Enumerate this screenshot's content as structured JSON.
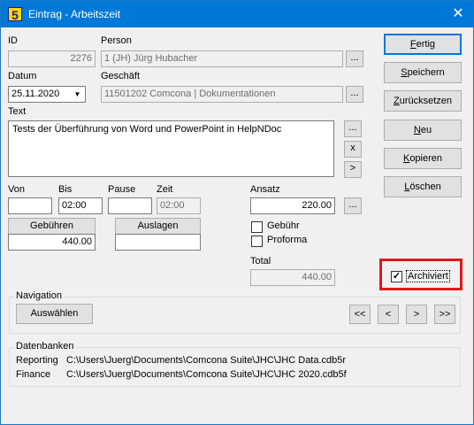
{
  "window": {
    "icon_text": "5",
    "title": "Eintrag - Arbeitszeit",
    "close_glyph": "✕"
  },
  "form": {
    "id_label": "ID",
    "id_value": "2276",
    "person_label": "Person",
    "person_value": "1 (JH) Jürg Hubacher",
    "datum_label": "Datum",
    "datum_value": "25.11.2020",
    "geschaeft_label": "Geschäft",
    "geschaeft_value": "11501202  Comcona | Dokumentationen",
    "text_label": "Text",
    "text_value": "Tests der Überführung von Word und PowerPoint in HelpNDoc",
    "browse_glyph": "...",
    "clear_glyph": "x",
    "next_glyph": ">",
    "von_label": "Von",
    "von_value": "",
    "bis_label": "Bis",
    "bis_value": "02:00",
    "pause_label": "Pause",
    "pause_value": "",
    "zeit_label": "Zeit",
    "zeit_value": "02:00",
    "ansatz_label": "Ansatz",
    "ansatz_value": "220.00",
    "gebuehren_button": "Gebühren",
    "gebuehren_value": "440.00",
    "auslagen_button": "Auslagen",
    "auslagen_value": "",
    "gebuehr_check_label": "Gebühr",
    "gebuehr_checked": false,
    "proforma_check_label": "Proforma",
    "proforma_checked": false,
    "total_label": "Total",
    "total_value": "440.00",
    "archiviert_label": "Archiviert",
    "archiviert_checked": true,
    "check_glyph": "✓"
  },
  "actions": {
    "fertig_pre": "",
    "fertig_u": "F",
    "fertig_post": "ertig",
    "speichern_pre": "",
    "speichern_u": "S",
    "speichern_post": "peichern",
    "zuruecksetzen_pre": "",
    "zuruecksetzen_u": "Z",
    "zuruecksetzen_post": "urücksetzen",
    "neu_pre": "",
    "neu_u": "N",
    "neu_post": "eu",
    "kopieren_pre": "",
    "kopieren_u": "K",
    "kopieren_post": "opieren",
    "loeschen_pre": "",
    "loeschen_u": "L",
    "loeschen_post": "öschen"
  },
  "navigation": {
    "group_title": "Navigation",
    "auswaehlen_label": "Auswählen",
    "first_glyph": "<<",
    "prev_glyph": "<",
    "next_glyph": ">",
    "last_glyph": ">>"
  },
  "datenbanken": {
    "group_title": "Datenbanken",
    "rows": [
      {
        "name": "Reporting",
        "path": "C:\\Users\\Juerg\\Documents\\Comcona Suite\\JHC\\JHC Data.cdb5r"
      },
      {
        "name": "Finance",
        "path": "C:\\Users\\Juerg\\Documents\\Comcona Suite\\JHC\\JHC 2020.cdb5f"
      }
    ]
  },
  "colors": {
    "titlebar": "#0078d7",
    "highlight": "#e0191a",
    "primary_border": "#0078d7"
  }
}
